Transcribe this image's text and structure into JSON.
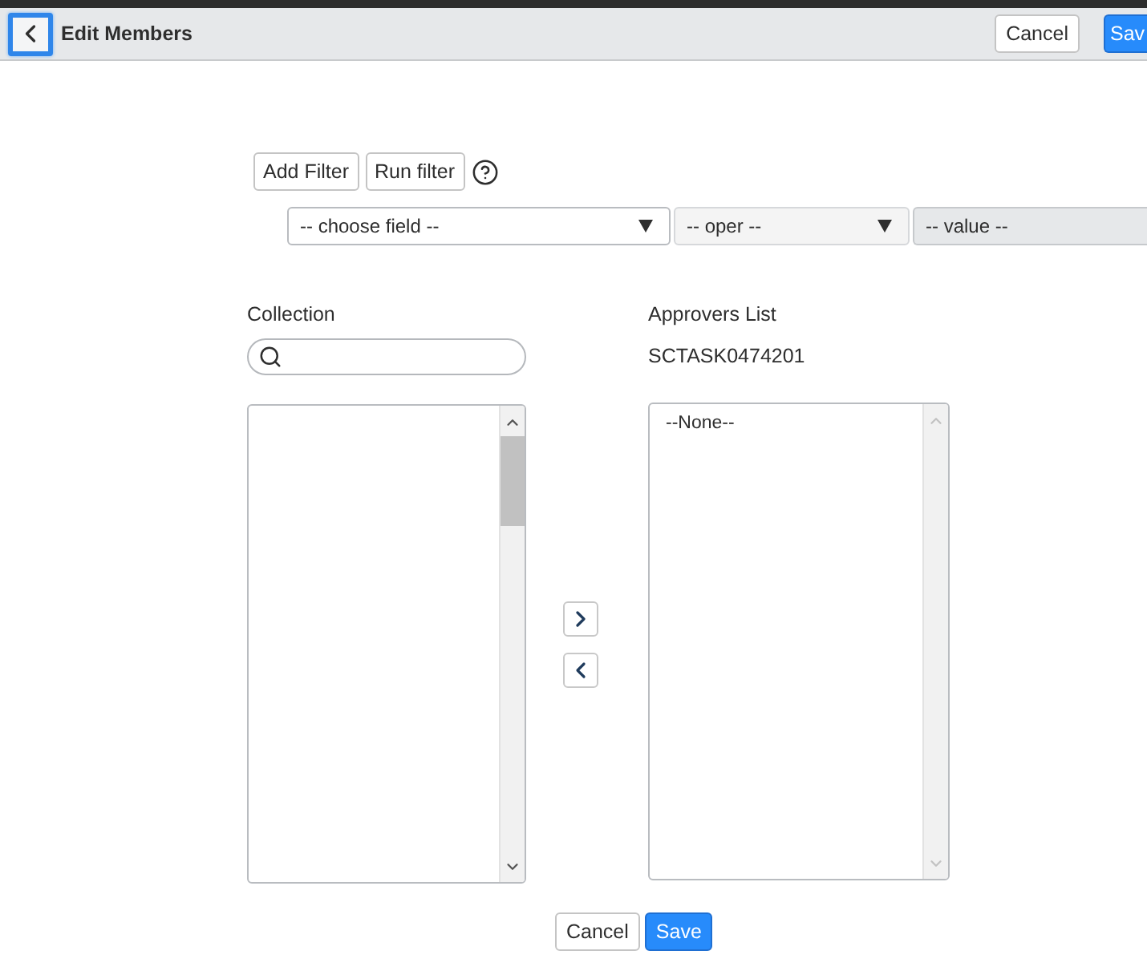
{
  "header": {
    "back_button": {
      "focused": true
    },
    "title": "Edit Members",
    "buttons": [
      {
        "label": "Cancel",
        "kind": "default"
      },
      {
        "label": "Sav",
        "kind": "primary"
      }
    ]
  },
  "filter": {
    "buttons": [
      "Add Filter",
      "Run filter"
    ],
    "fields": [
      {
        "kind": "select",
        "value": "-- choose field --",
        "disabled": false
      },
      {
        "kind": "select",
        "value": "-- oper --",
        "disabled": true
      },
      {
        "kind": "input",
        "value": "-- value --",
        "disabled": true
      }
    ]
  },
  "collection": {
    "label": "Collection"
  },
  "approvers": {
    "label": "Approvers List",
    "record": "SCTASK0474201",
    "options": [
      {
        "label": "--None--",
        "selected": false
      }
    ]
  },
  "footer": {
    "buttons": [
      {
        "label": "Cancel",
        "kind": "default"
      },
      {
        "label": "Save",
        "kind": "primary"
      }
    ]
  }
}
